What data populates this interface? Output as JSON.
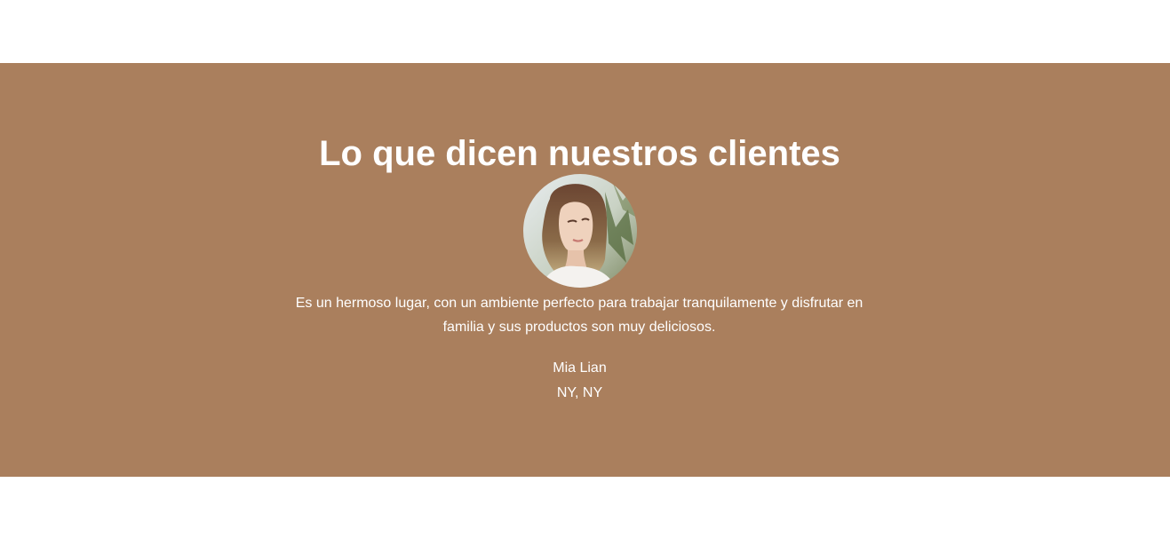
{
  "testimonials": {
    "heading": "Lo que dicen nuestros clientes",
    "background_color": "#aa7f5d",
    "text_color": "#ffffff",
    "avatar": {
      "icon": "customer-portrait-photo"
    },
    "quote": "Es un hermoso lugar, con un ambiente perfecto para trabajar tranquilamente y disfrutar en familia y sus productos son muy deliciosos.",
    "author_name": "Mia Lian",
    "author_location": "NY, NY"
  }
}
